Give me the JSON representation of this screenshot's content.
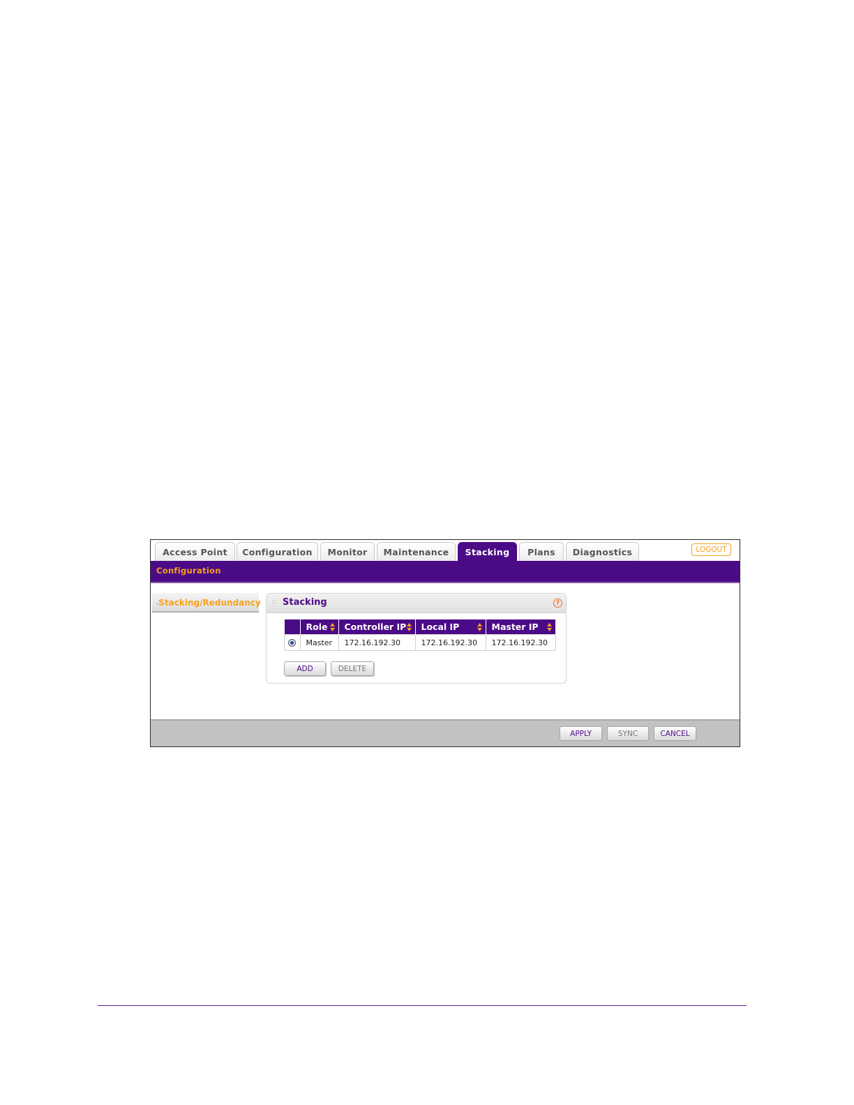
{
  "tabs": [
    {
      "label": "Access Point",
      "active": false
    },
    {
      "label": "Configuration",
      "active": false
    },
    {
      "label": "Monitor",
      "active": false
    },
    {
      "label": "Maintenance",
      "active": false
    },
    {
      "label": "Stacking",
      "active": true
    },
    {
      "label": "Plans",
      "active": false
    },
    {
      "label": "Diagnostics",
      "active": false
    }
  ],
  "logout_label": "LOGOUT",
  "subnav": {
    "item": "Configuration"
  },
  "sidemenu": {
    "item": "Stacking/Redundancy"
  },
  "panel": {
    "title": "Stacking",
    "help_icon": "?",
    "grip": "::"
  },
  "table": {
    "headers": [
      "Role",
      "Controller IP",
      "Local IP",
      "Master IP"
    ],
    "rows": [
      {
        "selected": true,
        "role": "Master",
        "controller_ip": "172.16.192.30",
        "local_ip": "172.16.192.30",
        "master_ip": "172.16.192.30"
      }
    ]
  },
  "panel_buttons": {
    "add": "ADD",
    "delete": "DELETE"
  },
  "footer_buttons": {
    "apply": "APPLY",
    "sync": "SYNC",
    "cancel": "CANCEL"
  },
  "colors": {
    "brand_purple": "#4b0a86",
    "accent_orange": "#f7a21b",
    "disabled_text": "#777777"
  }
}
